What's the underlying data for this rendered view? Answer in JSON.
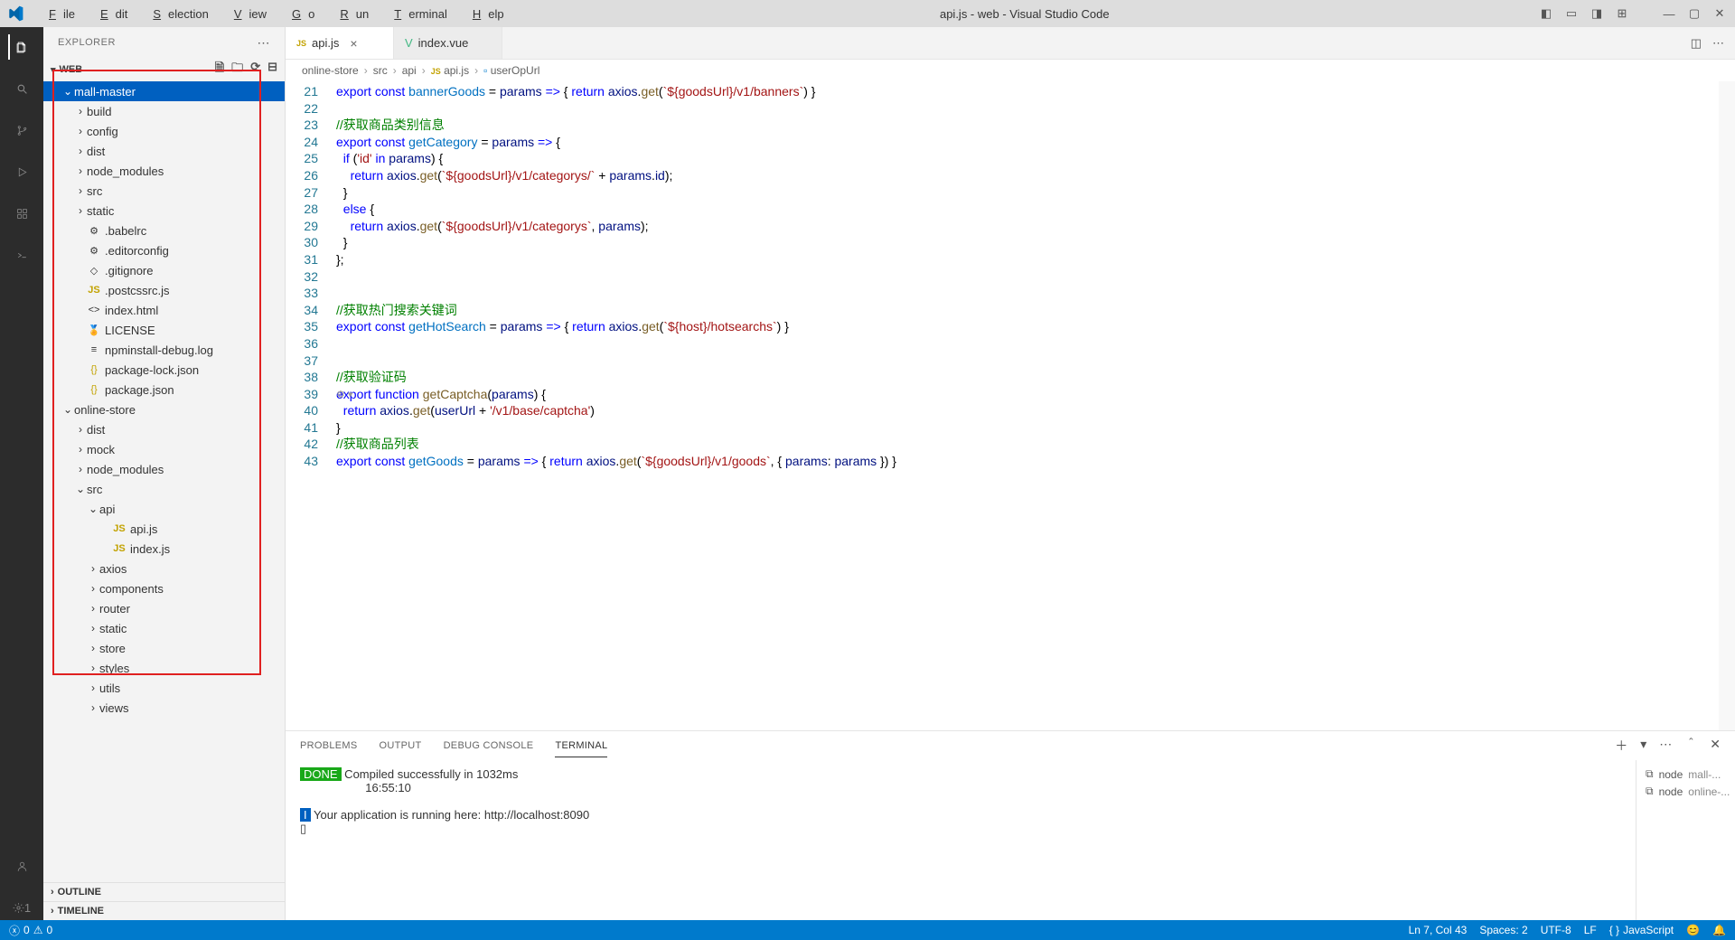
{
  "title": "api.js - web - Visual Studio Code",
  "menus": [
    "File",
    "Edit",
    "Selection",
    "View",
    "Go",
    "Run",
    "Terminal",
    "Help"
  ],
  "explorer_label": "EXPLORER",
  "workspace": "WEB",
  "outline_label": "OUTLINE",
  "timeline_label": "TIMELINE",
  "tree": [
    {
      "depth": 1,
      "chev": "v",
      "label": "mall-master",
      "sel": true
    },
    {
      "depth": 2,
      "chev": ">",
      "label": "build"
    },
    {
      "depth": 2,
      "chev": ">",
      "label": "config"
    },
    {
      "depth": 2,
      "chev": ">",
      "label": "dist"
    },
    {
      "depth": 2,
      "chev": ">",
      "label": "node_modules"
    },
    {
      "depth": 2,
      "chev": ">",
      "label": "src"
    },
    {
      "depth": 2,
      "chev": ">",
      "label": "static"
    },
    {
      "depth": 2,
      "icon": "⚙",
      "label": ".babelrc"
    },
    {
      "depth": 2,
      "icon": "⚙",
      "label": ".editorconfig"
    },
    {
      "depth": 2,
      "icon": "◇",
      "label": ".gitignore"
    },
    {
      "depth": 2,
      "icon": "JS",
      "iconcls": "js",
      "label": ".postcssrc.js"
    },
    {
      "depth": 2,
      "icon": "<>",
      "label": "index.html"
    },
    {
      "depth": 2,
      "icon": "🏅",
      "label": "LICENSE"
    },
    {
      "depth": 2,
      "icon": "≡",
      "label": "npminstall-debug.log"
    },
    {
      "depth": 2,
      "icon": "{}",
      "iconcls": "json",
      "label": "package-lock.json"
    },
    {
      "depth": 2,
      "icon": "{}",
      "iconcls": "json",
      "label": "package.json"
    },
    {
      "depth": 1,
      "chev": "v",
      "label": "online-store"
    },
    {
      "depth": 2,
      "chev": ">",
      "label": "dist"
    },
    {
      "depth": 2,
      "chev": ">",
      "label": "mock"
    },
    {
      "depth": 2,
      "chev": ">",
      "label": "node_modules"
    },
    {
      "depth": 2,
      "chev": "v",
      "label": "src"
    },
    {
      "depth": 3,
      "chev": "v",
      "label": "api"
    },
    {
      "depth": 4,
      "icon": "JS",
      "iconcls": "js",
      "label": "api.js"
    },
    {
      "depth": 4,
      "icon": "JS",
      "iconcls": "js",
      "label": "index.js"
    },
    {
      "depth": 3,
      "chev": ">",
      "label": "axios"
    },
    {
      "depth": 3,
      "chev": ">",
      "label": "components"
    },
    {
      "depth": 3,
      "chev": ">",
      "label": "router"
    },
    {
      "depth": 3,
      "chev": ">",
      "label": "static"
    },
    {
      "depth": 3,
      "chev": ">",
      "label": "store"
    },
    {
      "depth": 3,
      "chev": ">",
      "label": "styles"
    },
    {
      "depth": 3,
      "chev": ">",
      "label": "utils"
    },
    {
      "depth": 3,
      "chev": ">",
      "label": "views"
    }
  ],
  "tabs": [
    {
      "icon": "JS",
      "iconcls": "js",
      "label": "api.js",
      "active": true,
      "close": true
    },
    {
      "icon": "V",
      "iconcls": "vue",
      "label": "index.vue",
      "active": false,
      "close": false
    }
  ],
  "breadcrumb": [
    "online-store",
    "src",
    "api",
    "api.js",
    "userOpUrl"
  ],
  "code_start": 21,
  "code_lines": [
    "<span class='kw'>export</span> <span class='kw'>const</span> <span class='const'>bannerGoods</span> <span class='op'>=</span> <span class='prm'>params</span> <span class='kw'>=></span> { <span class='kw'>return</span> <span class='id'>axios</span>.<span class='fn'>get</span>(<span class='tmpl'>`${goodsUrl}/v1/banners`</span>) }",
    "",
    "<span class='cm'>//获取商品类别信息</span>",
    "<span class='kw'>export</span> <span class='kw'>const</span> <span class='const'>getCategory</span> <span class='op'>=</span> <span class='prm'>params</span> <span class='kw'>=></span> {",
    "  <span class='kw'>if</span> (<span class='str'>'id'</span> <span class='kw'>in</span> <span class='id'>params</span>) {",
    "    <span class='kw'>return</span> <span class='id'>axios</span>.<span class='fn'>get</span>(<span class='tmpl'>`${goodsUrl}/v1/categorys/`</span> + <span class='id'>params</span>.<span class='id'>id</span>);",
    "  }",
    "  <span class='kw'>else</span> {",
    "    <span class='kw'>return</span> <span class='id'>axios</span>.<span class='fn'>get</span>(<span class='tmpl'>`${goodsUrl}/v1/categorys`</span>, <span class='id'>params</span>);",
    "  }",
    "};",
    "",
    "",
    "<span class='cm'>//获取热门搜索关键词</span>",
    "<span class='kw'>export</span> <span class='kw'>const</span> <span class='const'>getHotSearch</span> <span class='op'>=</span> <span class='prm'>params</span> <span class='kw'>=></span> { <span class='kw'>return</span> <span class='id'>axios</span>.<span class='fn'>get</span>(<span class='tmpl'>`${host}/hotsearchs`</span>) }",
    "",
    "",
    "<span class='cm'>//获取验证码</span>",
    "<span class='kw'>export</span> <span class='kw'>function</span> <span class='fn'>getCaptcha</span>(<span class='prm'>params</span>) {",
    "  <span class='kw'>return</span> <span class='id'>axios</span>.<span class='fn'>get</span>(<span class='id'>userUrl</span> + <span class='str'>'/v1/base/captcha'</span>)",
    "}",
    "<span class='cm'>//获取商品列表</span>",
    "<span class='kw'>export</span> <span class='kw'>const</span> <span class='const'>getGoods</span> <span class='op'>=</span> <span class='prm'>params</span> <span class='kw'>=></span> { <span class='kw'>return</span> <span class='id'>axios</span>.<span class='fn'>get</span>(<span class='tmpl'>`${goodsUrl}/v1/goods`</span>, { <span class='id'>params</span>: <span class='id'>params</span> }) }"
  ],
  "panel_tabs": [
    "PROBLEMS",
    "OUTPUT",
    "DEBUG CONSOLE",
    "TERMINAL"
  ],
  "panel_active": 3,
  "terminal": {
    "done_label": "DONE",
    "done_text": " Compiled successfully in 1032ms",
    "time": "16:55:10",
    "info_badge": "I",
    "info_text": " Your application is running here: http://localhost:8090",
    "shells": [
      {
        "icon": "⧉",
        "cmd": "node",
        "label": "mall-..."
      },
      {
        "icon": "⧉",
        "cmd": "node",
        "label": "online-..."
      }
    ]
  },
  "status": {
    "errors": "0",
    "warnings": "0",
    "lncol": "Ln 7, Col 43",
    "spaces": "Spaces: 2",
    "enc": "UTF-8",
    "eol": "LF",
    "lang": "JavaScript"
  }
}
